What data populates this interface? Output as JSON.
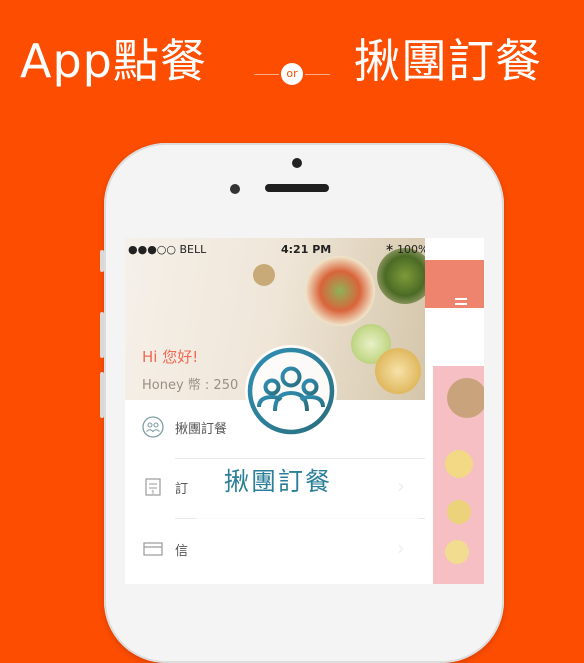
{
  "banner": {
    "left_title": "App點餐",
    "right_title": "揪團訂餐",
    "or_label": "or"
  },
  "status_bar": {
    "carrier": "●●●○○ BELL",
    "time": "4:21 PM",
    "battery": "100%"
  },
  "app": {
    "greeting": "Hi 您好!",
    "points": "Honey 幣 : 250",
    "menu_items": [
      {
        "label": "揪團訂餐",
        "icon": "group-icon",
        "has_chevron": false
      },
      {
        "label": "訂",
        "icon": "receipt-icon",
        "has_chevron": true
      },
      {
        "label": "信",
        "icon": "card-icon",
        "has_chevron": true
      }
    ]
  },
  "logo": {
    "title": "揪團訂餐",
    "icon": "group-people-icon"
  },
  "colors": {
    "background": "#fc4d00",
    "accent": "#ee846e",
    "logo_teal": "#2b7f98"
  }
}
